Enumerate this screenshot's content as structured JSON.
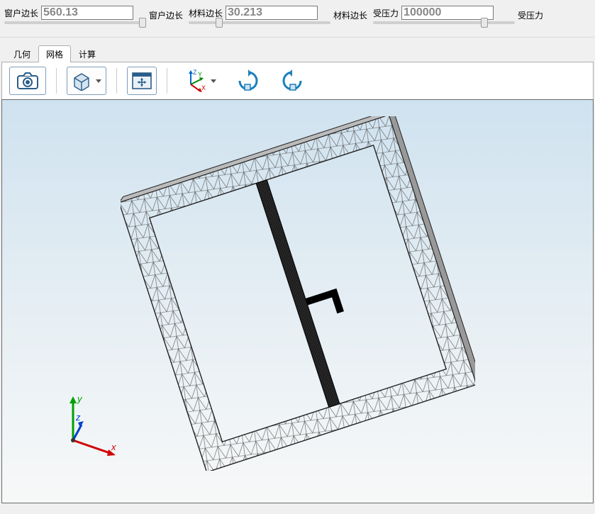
{
  "controls": {
    "window_len": {
      "label": "窗户边长",
      "value": "560.13",
      "label2": "窗户边长",
      "slider": 100
    },
    "material_len": {
      "label": "材料边长",
      "value": "30.213",
      "label2": "材料边长",
      "slider": 20
    },
    "pressure": {
      "label": "受压力",
      "value": "100000",
      "label2": "受压力",
      "slider": 80
    }
  },
  "tabs": {
    "geometry": "几何",
    "mesh": "网格",
    "compute": "计算",
    "active": "mesh"
  },
  "toolbar": {
    "snapshot": "snapshot",
    "view_mode": "view-mode",
    "pan": "pan",
    "axes": "axes",
    "rotate_cw": "rotate-clockwise",
    "rotate_ccw": "rotate-counterclockwise"
  },
  "axes": {
    "x": "x",
    "y": "y",
    "z": "z",
    "tb_x": "X",
    "tb_y": "Y",
    "tb_z": "Z"
  }
}
